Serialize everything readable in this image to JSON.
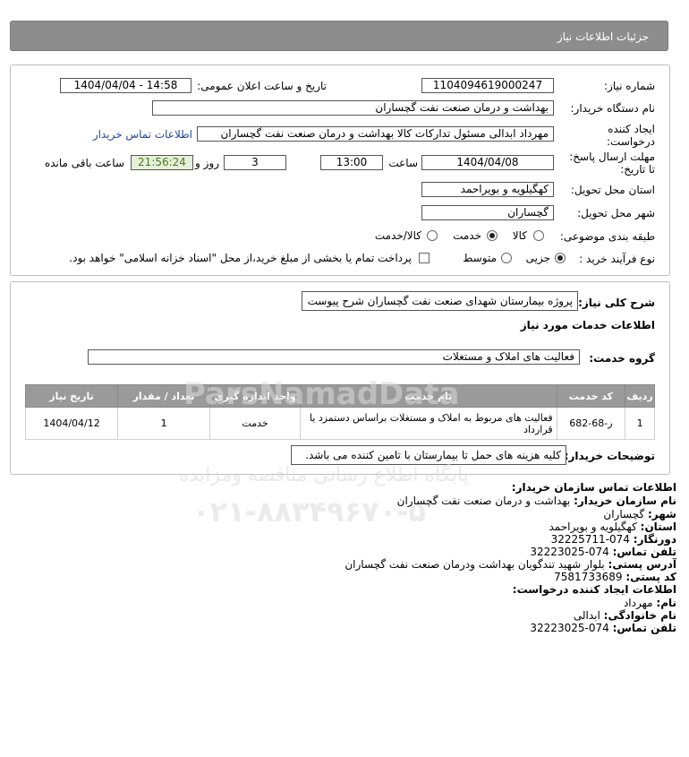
{
  "header": {
    "title": "جزئیات اطلاعات نیاز"
  },
  "form": {
    "need_number_label": "شماره نیاز:",
    "need_number": "1104094619000247",
    "announce_label": "تاریخ و ساعت اعلان عمومی:",
    "announce_value": "1404/04/04 - 14:58",
    "buyer_org_label": "نام دستگاه خریدار:",
    "buyer_org": "بهداشت و درمان صنعت نفت گچساران",
    "creator_label_1": "ایجاد کننده",
    "creator_label_2": "درخواست:",
    "creator": "مهرداد ابدالی مسئول تدارکات کالا  بهداشت و درمان صنعت نفت گچساران",
    "contact_link": "اطلاعات تماس خریدار",
    "deadline_label_1": "مهلت ارسال پاسخ:",
    "deadline_label_2": "تا تاریخ:",
    "deadline_date": "1404/04/08",
    "time_label": "ساعت",
    "deadline_time": "13:00",
    "days_value": "3",
    "days_label": "روز و",
    "remaining_time": "21:56:24",
    "remaining_label": "ساعت باقی مانده",
    "province_label": "استان محل تحویل:",
    "province": "کهگیلویه و بویراحمد",
    "city_label": "شهر محل تحویل:",
    "city": "گچساران",
    "category_label": "طبقه بندی موضوعی:",
    "category_options": [
      "کالا",
      "خدمت",
      "کالا/خدمت"
    ],
    "category_selected": "خدمت",
    "process_label": "نوع فرآیند خرید :",
    "process_options": [
      "جزیی",
      "متوسط"
    ],
    "process_selected": "جزیی",
    "payment_text": "پرداخت تمام یا بخشی از مبلغ خرید،از محل \"اسناد خزانه اسلامی\" خواهد بود."
  },
  "details": {
    "summary_label": "شرح کلی نیاز:",
    "summary": "پروژه بیمارستان شهدای صنعت نفت گچساران شرح پیوست",
    "services_heading": "اطلاعات خدمات مورد نیاز",
    "service_group_label": "گروه خدمت:",
    "service_group": "فعالیت های  املاک و مستغلات",
    "table_headers": [
      "ردیف",
      "کد خدمت",
      "نام خدمت",
      "واحد اندازه گیری",
      "تعداد / مقدار",
      "تاریخ نیاز"
    ],
    "rows": [
      {
        "index": "1",
        "code": "ر-68-682",
        "name": "فعالیت های مربوط به املاک و مستغلات براساس دستمزد یا قرارداد",
        "unit": "خدمت",
        "qty": "1",
        "date": "1404/04/12"
      }
    ],
    "buyer_notes_label": "توضیحات خریدار:",
    "buyer_notes": "کلیه هزینه های حمل تا بیمارستان با تامین کننده می باشد."
  },
  "contact": {
    "heading": "اطلاعات تماس سازمان خریدار:",
    "org_label": "نام سازمان خریدار:",
    "org": "بهداشت و درمان صنعت نفت گچساران",
    "city_label": "شهر:",
    "city": "گچساران",
    "province_label": "استان:",
    "province": "کهگیلویه و بویراحمد",
    "fax_label": "دورنگار:",
    "fax": "074-32225711",
    "phone_label": "تلفن تماس:",
    "phone": "074-32223025",
    "address_label": "آدرس پستی:",
    "address": "بلوار شهید تندگویان بهداشت ودرمان صنعت نفت گچساران",
    "postal_label": "کد پستی:",
    "postal": "7581733689",
    "creator_heading": "اطلاعات ایجاد کننده درخواست:",
    "first_name_label": "نام:",
    "first_name": "مهرداد",
    "last_name_label": "نام خانوادگی:",
    "last_name": "ابدالی",
    "creator_phone_label": "تلفن تماس:",
    "creator_phone": "074-32223025"
  },
  "watermark": {
    "brand": "ParsNamadData",
    "line1": "پایگاه اطلاع رسانی مناقصه ومزایده",
    "phone": "۰۲۱-۸۸۳۴۹۶۷۰-۵"
  },
  "colors": {
    "header_bg": "#8d8d8d",
    "table_header_bg": "#9a9a9a",
    "link": "#1a4a9c",
    "remaining_bg": "#e6f0d8"
  }
}
